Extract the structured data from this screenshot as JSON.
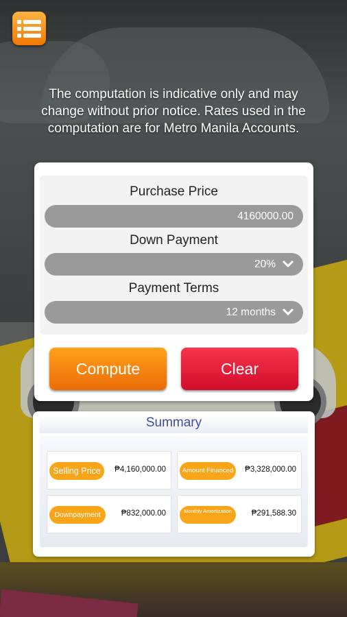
{
  "notice": "The computation is indicative only and may change without prior notice. Rates used in the computation are for Metro Manila Accounts.",
  "form": {
    "purchase_price_label": "Purchase Price",
    "purchase_price_value": "4160000.00",
    "down_payment_label": "Down Payment",
    "down_payment_value": "20%",
    "payment_terms_label": "Payment Terms",
    "payment_terms_value": "12 months",
    "compute_label": "Compute",
    "clear_label": "Clear"
  },
  "summary": {
    "title": "Summary",
    "items": [
      {
        "label": "Selling Price",
        "value": "₱4,160,000.00"
      },
      {
        "label": "Amount Financed",
        "value": "₱3,328,000.00"
      },
      {
        "label": "Downpayment",
        "value": "₱832,000.00"
      },
      {
        "label": "Monthly Amortization",
        "value": "₱291,588.30"
      }
    ]
  },
  "colors": {
    "accent_orange": "#f9a51a",
    "compute_orange": "#ec6b06",
    "clear_red": "#d10c2c",
    "summary_title": "#3c4ba0"
  },
  "icons": {
    "menu": "menu-list-icon",
    "dropdown": "chevron-down-icon"
  }
}
